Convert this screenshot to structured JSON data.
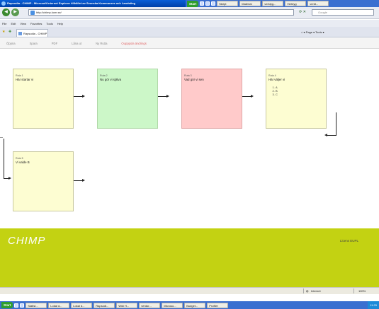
{
  "window": {
    "title": "Rapsodia - CHIMP - Microsoft Internet Explorer tillhållet av Svenska Kommuners och Landsting"
  },
  "top_taskbar": {
    "start_label": "Start",
    "items": [
      "Skript",
      "Material",
      "verktyg...",
      "Verktyg",
      "verkt..."
    ]
  },
  "address_bar": {
    "back_icon": "back-arrow-icon",
    "forward_icon": "forward-arrow-icon",
    "url": "http://chimp.kom.se/",
    "search_placeholder": "Google"
  },
  "menu": {
    "items": [
      "File",
      "Edit",
      "View",
      "Favorites",
      "Tools",
      "Help"
    ]
  },
  "tab": {
    "label": "Rapsodia - CHIMP"
  },
  "command_bar": {
    "label": "Page ▾  Tools ▾"
  },
  "app_nav": {
    "items": [
      {
        "label": "Öppna",
        "active": false
      },
      {
        "label": "Spara",
        "active": false
      },
      {
        "label": "PDF",
        "active": false
      },
      {
        "label": "Låna ut",
        "active": false
      },
      {
        "label": "Ny Rutta",
        "active": false
      },
      {
        "label": "Oupppola ändrings",
        "active": true
      }
    ]
  },
  "boxes": [
    {
      "title": "Ruta 1",
      "text": "Här startar vi",
      "color": "#fdfdd2"
    },
    {
      "title": "Ruta 2",
      "text": "Nu gör vi själva",
      "color": "#ccf7c8"
    },
    {
      "title": "Ruta 3",
      "text": "Vad gör vi sen",
      "color": "#ffcaca"
    },
    {
      "title": "Ruta 4",
      "text": "Här väljer vi",
      "color": "#fdfdd2",
      "list": [
        "A",
        "B",
        "C"
      ]
    },
    {
      "title": "Ruta 5",
      "text": "Vi valde B",
      "color": "#fdfdd2"
    }
  ],
  "footer": {
    "logo": "CHIMP",
    "license": "Licens EUPL",
    "color": "#c3d212"
  },
  "status_bar": {
    "zone": "Internet",
    "zoom": "100%"
  },
  "bottom_taskbar": {
    "start_label": "Start",
    "items": [
      "Statist...",
      "Lokal d...",
      "Lokal d...",
      "Rapsodi...",
      "Wiki H...",
      "verdor...",
      "Microso...",
      "Budget...",
      "Profiler",
      "Nature..."
    ],
    "clock": "11:25"
  }
}
